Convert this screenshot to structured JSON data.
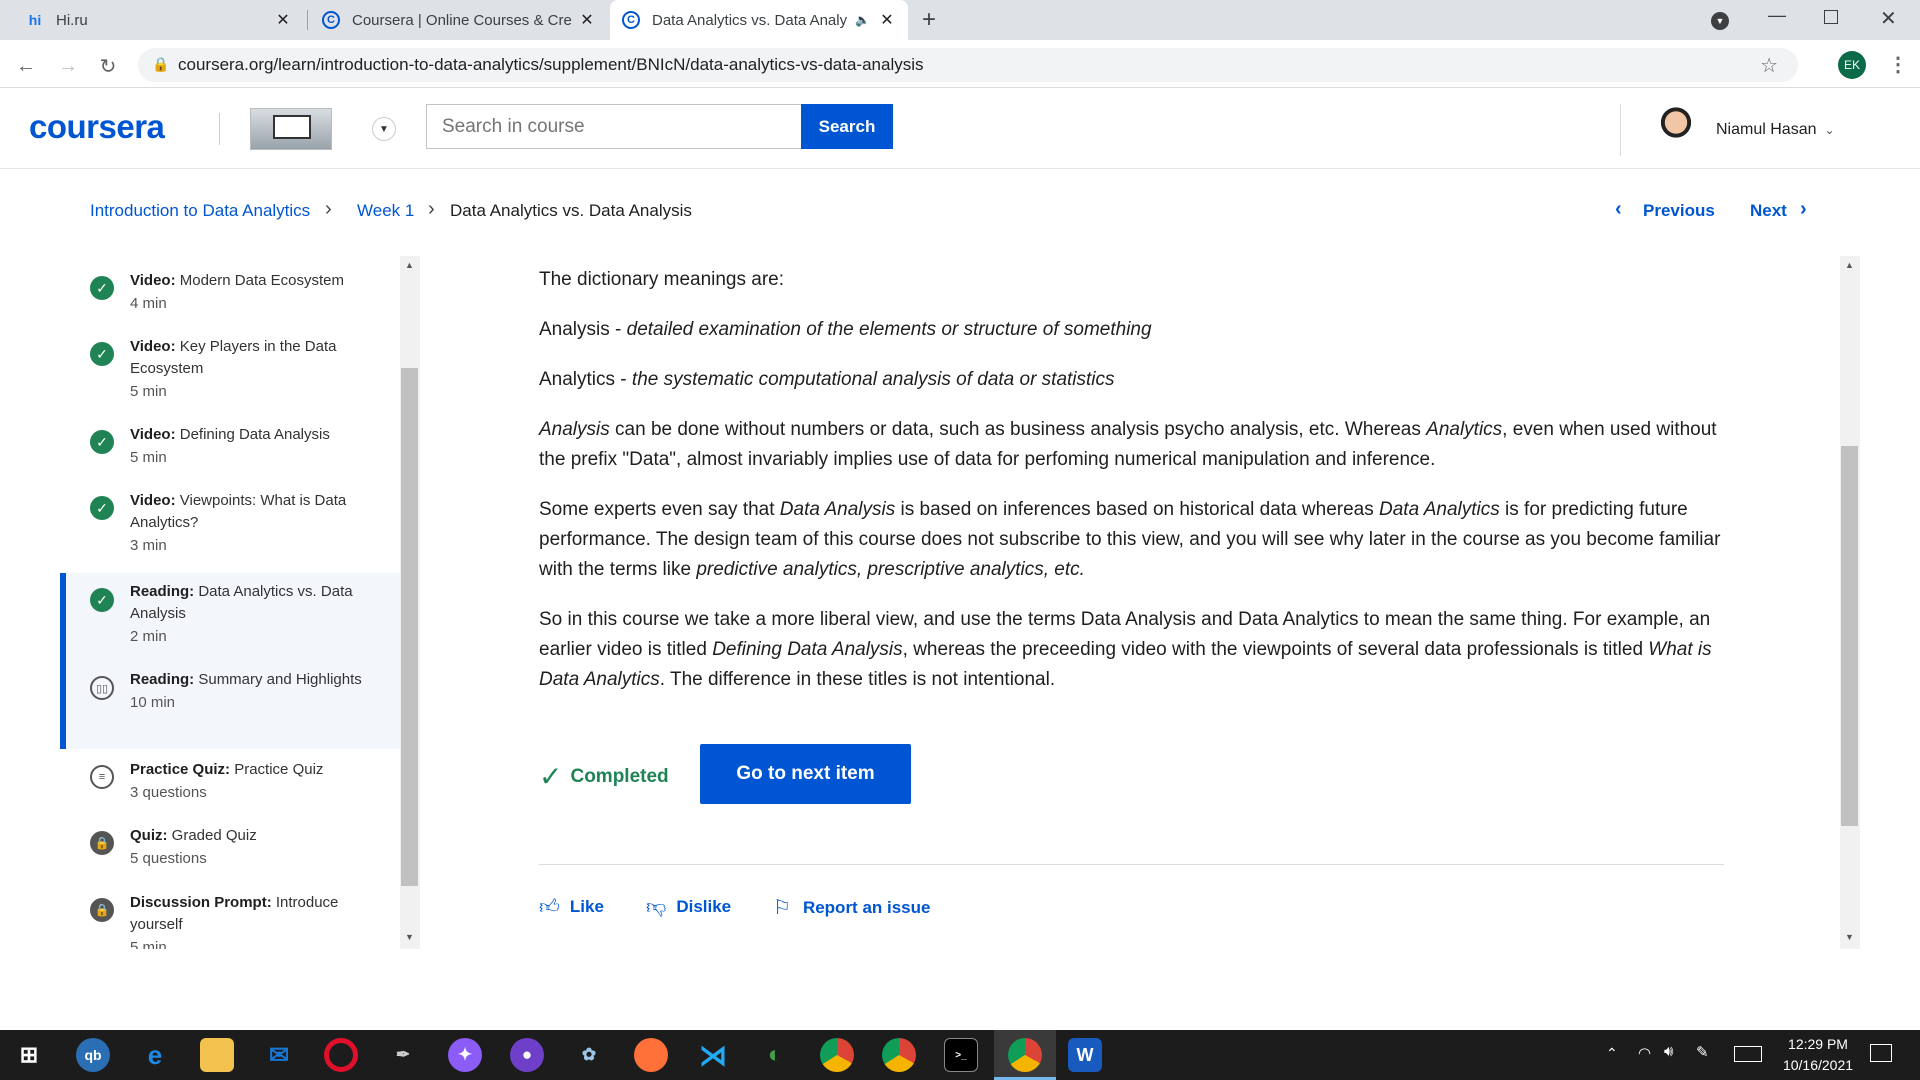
{
  "browser": {
    "tabs": [
      {
        "title": "Hi.ru",
        "favicon": "hi"
      },
      {
        "title": "Coursera | Online Courses & Cre",
        "favicon": "C"
      },
      {
        "title": "Data Analytics vs. Data Analy",
        "favicon": "C"
      }
    ],
    "url": "coursera.org/learn/introduction-to-data-analytics/supplement/BNIcN/data-analytics-vs-data-analysis",
    "profile_initials": "EK"
  },
  "header": {
    "logo": "coursera",
    "search_placeholder": "Search in course",
    "search_label": "Search",
    "user_name": "Niamul Hasan"
  },
  "breadcrumb": {
    "course": "Introduction to Data Analytics",
    "week": "Week 1",
    "current": "Data Analytics vs. Data Analysis",
    "previous": "Previous",
    "next": "Next"
  },
  "sidebar": {
    "items": [
      {
        "type": "Video:",
        "title": "Modern Data Ecosystem",
        "meta": "4 min"
      },
      {
        "type": "Video:",
        "title": "Key Players in the Data Ecosystem",
        "meta": "5 min"
      },
      {
        "type": "Video:",
        "title": "Defining Data Analysis",
        "meta": "5 min"
      },
      {
        "type": "Video:",
        "title": "Viewpoints: What is Data Analytics?",
        "meta": "3 min"
      },
      {
        "type": "Reading:",
        "title": "Data Analytics vs. Data Analysis",
        "meta": "2 min"
      },
      {
        "type": "Reading:",
        "title": "Summary and Highlights",
        "meta": "10 min"
      },
      {
        "type": "Practice Quiz:",
        "title": "Practice Quiz",
        "meta": "3 questions"
      },
      {
        "type": "Quiz:",
        "title": "Graded Quiz",
        "meta": "5 questions"
      },
      {
        "type": "Discussion Prompt:",
        "title": "Introduce yourself",
        "meta": "5 min"
      }
    ]
  },
  "content": {
    "p1": "The dictionary meanings are:",
    "p2_a": "Analysis - ",
    "p2_b": "detailed examination of the elements or structure of something",
    "p3_a": "Analytics - ",
    "p3_b": "the systematic computational analysis of data or statistics",
    "p4_a": "Analysis",
    "p4_b": " can be done without numbers or data, such as business analysis psycho analysis, etc. Whereas ",
    "p4_c": "Analytics",
    "p4_d": ", even when used without the prefix \"Data\", almost invariably implies use of data for perfoming numerical manipulation and inference.",
    "p5_a": "Some experts even say that ",
    "p5_b": "Data Analysis",
    "p5_c": " is based on inferences based on historical data whereas ",
    "p5_d": "Data Analytics",
    "p5_e": " is for predicting future performance. The design team of this course does not subscribe to this view, and you will see why later in the course as you become familiar with the terms like ",
    "p5_f": "predictive analytics, prescriptive analytics, etc.",
    "p6_a": "So in this course we take a more liberal view, and use the terms Data Analysis and Data Analytics to mean the same thing. For example, an earlier video is titled ",
    "p6_b": "Defining Data Analysis",
    "p6_c": ", whereas the preceeding video with the viewpoints of several data professionals is titled ",
    "p6_d": "What is Data Analytics",
    "p6_e": ". The difference in these titles is not intentional.",
    "completed": "Completed",
    "next_item": "Go to next item",
    "like": "Like",
    "dislike": "Dislike",
    "report": "Report an issue"
  },
  "taskbar": {
    "time": "12:29 PM",
    "date": "10/16/2021"
  },
  "colors": {
    "brand": "#0056d2",
    "success": "#1f8354"
  }
}
